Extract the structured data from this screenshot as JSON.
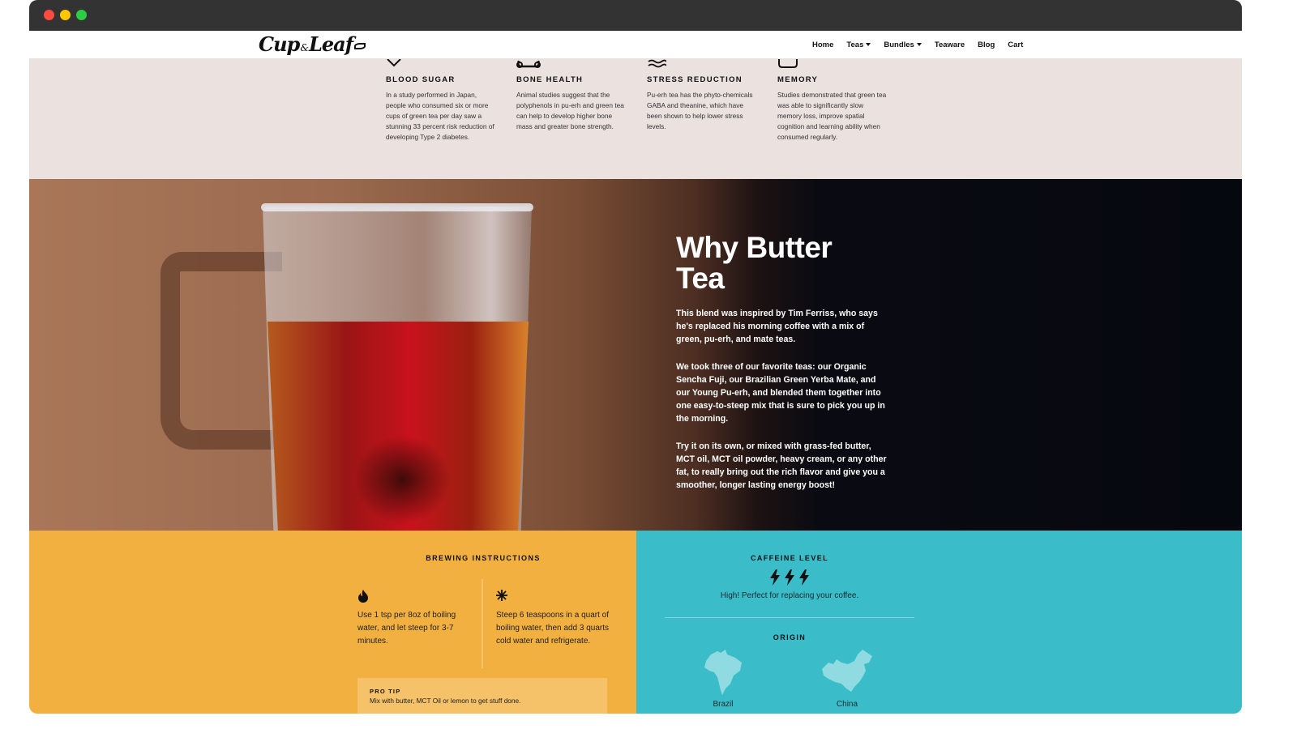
{
  "browser": {
    "buttons": [
      "close",
      "minimize",
      "maximize"
    ]
  },
  "header": {
    "logo": {
      "part1": "Cup",
      "amp": "&",
      "part2": "Leaf"
    },
    "nav": [
      {
        "label": "Home",
        "dropdown": false
      },
      {
        "label": "Teas",
        "dropdown": true
      },
      {
        "label": "Bundles",
        "dropdown": true
      },
      {
        "label": "Teaware",
        "dropdown": false
      },
      {
        "label": "Blog",
        "dropdown": false
      },
      {
        "label": "Cart",
        "dropdown": false
      }
    ]
  },
  "benefits": [
    {
      "icon": "chevron-down-icon",
      "title": "BLOOD SUGAR",
      "text": "In a study performed in Japan, people who consumed six or more cups of green tea per day saw a stunning 33 percent risk reduction of developing Type 2 diabetes."
    },
    {
      "icon": "bone-icon",
      "title": "BONE HEALTH",
      "text": "Animal studies suggest that the polyphenols in pu-erh and green tea can help to develop higher bone mass and greater bone strength."
    },
    {
      "icon": "waves-icon",
      "title": "STRESS REDUCTION",
      "text": "Pu-erh tea has the phyto-chemicals GABA and theanine, which have been shown to help lower stress levels."
    },
    {
      "icon": "brain-icon",
      "title": "MEMORY",
      "text": "Studies demonstrated that green tea was able to significantly slow memory loss, improve spatial cognition and learning ability when consumed regularly."
    }
  ],
  "hero": {
    "title_line1": "Why Butter",
    "title_line2": "Tea",
    "paragraphs": [
      "This blend was inspired by Tim Ferriss, who says he's replaced his morning coffee with a mix of green, pu-erh, and mate teas.",
      "We took three of our favorite teas: our Organic Sencha Fuji, our Brazilian Green Yerba Mate, and our Young Pu-erh, and blended them together into one easy-to-steep mix that is sure to pick you up in the morning.",
      "Try it on its own, or mixed with grass-fed butter, MCT oil, MCT oil powder, heavy cream, or any other fat, to really bring out the rich flavor and give you a smoother, longer lasting energy boost!"
    ]
  },
  "brewing": {
    "title": "BREWING INSTRUCTIONS",
    "hot": {
      "icon": "flame-icon",
      "text": "Use 1 tsp per 8oz of boiling water, and let steep for 3-7 minutes."
    },
    "iced": {
      "icon": "snowflake-icon",
      "text": "Steep 6 teaspoons in a quart of boiling water, then add 3 quarts cold water and refrigerate."
    },
    "pro_tip": {
      "label": "PRO TIP",
      "text": "Mix with butter, MCT Oil or lemon to get stuff done."
    }
  },
  "caffeine": {
    "title": "CAFFEINE LEVEL",
    "level": 3,
    "max_level": 3,
    "description": "High! Perfect for replacing your coffee.",
    "origin_title": "ORIGIN",
    "origins": [
      {
        "icon": "brazil-map-icon",
        "name": "Brazil"
      },
      {
        "icon": "china-map-icon",
        "name": "China"
      }
    ]
  },
  "colors": {
    "benefits_bg": "#ebe1df",
    "hero_dark": "#060810",
    "brewing_bg": "#f2b041",
    "pro_tip_bg": "#f5c26a",
    "caffeine_bg": "#3bbdc9",
    "map_fill": "#8fdbe1"
  }
}
